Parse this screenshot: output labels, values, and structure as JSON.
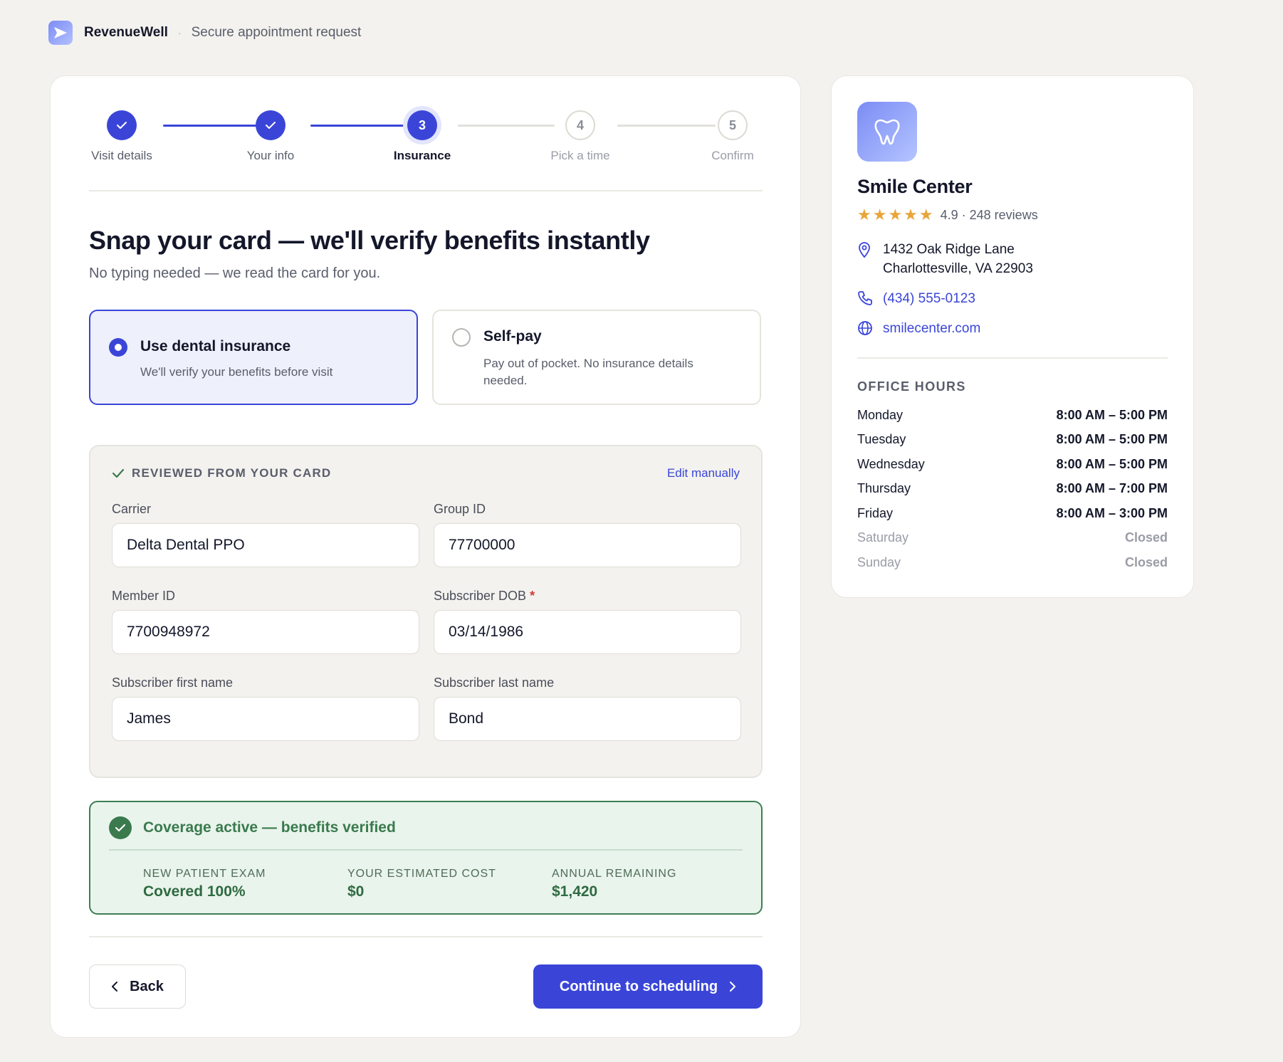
{
  "header": {
    "brand": "RevenueWell",
    "separator": "·",
    "tagline": "Secure appointment request"
  },
  "stepper": {
    "steps": [
      {
        "label": "Visit details",
        "state": "done",
        "number": "1"
      },
      {
        "label": "Your info",
        "state": "done",
        "number": "2"
      },
      {
        "label": "Insurance",
        "state": "active",
        "number": "3"
      },
      {
        "label": "Pick a time",
        "state": "todo",
        "number": "4"
      },
      {
        "label": "Confirm",
        "state": "todo",
        "number": "5"
      }
    ]
  },
  "main": {
    "title": "Snap your card — we'll verify benefits instantly",
    "subtitle": "No typing needed — we read the card for you.",
    "options": [
      {
        "title": "Use dental insurance",
        "desc": "We'll verify your benefits before visit",
        "selected": true
      },
      {
        "title": "Self-pay",
        "desc": "Pay out of pocket. No insurance details needed.",
        "selected": false
      }
    ],
    "review": {
      "heading": "REVIEWED FROM YOUR CARD",
      "edit_label": "Edit manually",
      "fields": {
        "carrier": {
          "label": "Carrier",
          "value": "Delta Dental PPO"
        },
        "group_id": {
          "label": "Group ID",
          "value": "77700000"
        },
        "member_id": {
          "label": "Member ID",
          "value": "7700948972"
        },
        "subscriber_dob": {
          "label": "Subscriber DOB",
          "required_mark": "*",
          "value": "03/14/1986"
        },
        "first_name": {
          "label": "Subscriber first name",
          "value": "James"
        },
        "last_name": {
          "label": "Subscriber last name",
          "value": "Bond"
        }
      }
    },
    "coverage": {
      "title": "Coverage active — benefits verified",
      "stats": [
        {
          "label": "NEW PATIENT EXAM",
          "value": "Covered 100%"
        },
        {
          "label": "YOUR ESTIMATED COST",
          "value": "$0"
        },
        {
          "label": "ANNUAL REMAINING",
          "value": "$1,420"
        }
      ]
    },
    "buttons": {
      "back": "Back",
      "continue": "Continue to scheduling"
    }
  },
  "sidebar": {
    "clinic_name": "Smile Center",
    "rating": "4.9 · 248 reviews",
    "star_count": 5,
    "address_line1": "1432 Oak Ridge Lane",
    "address_line2": "Charlottesville, VA 22903",
    "phone": "(434) 555-0123",
    "website": "smilecenter.com",
    "hours_title": "OFFICE HOURS",
    "hours": [
      {
        "day": "Monday",
        "time": "8:00 AM – 5:00 PM",
        "closed": false
      },
      {
        "day": "Tuesday",
        "time": "8:00 AM – 5:00 PM",
        "closed": false
      },
      {
        "day": "Wednesday",
        "time": "8:00 AM – 5:00 PM",
        "closed": false
      },
      {
        "day": "Thursday",
        "time": "8:00 AM – 7:00 PM",
        "closed": false
      },
      {
        "day": "Friday",
        "time": "8:00 AM – 3:00 PM",
        "closed": false
      },
      {
        "day": "Saturday",
        "time": "Closed",
        "closed": true
      },
      {
        "day": "Sunday",
        "time": "Closed",
        "closed": true
      }
    ]
  },
  "colors": {
    "accent": "#3a45d8",
    "success": "#3a7a4d",
    "star": "#e7a53a",
    "background": "#f3f2ee"
  }
}
